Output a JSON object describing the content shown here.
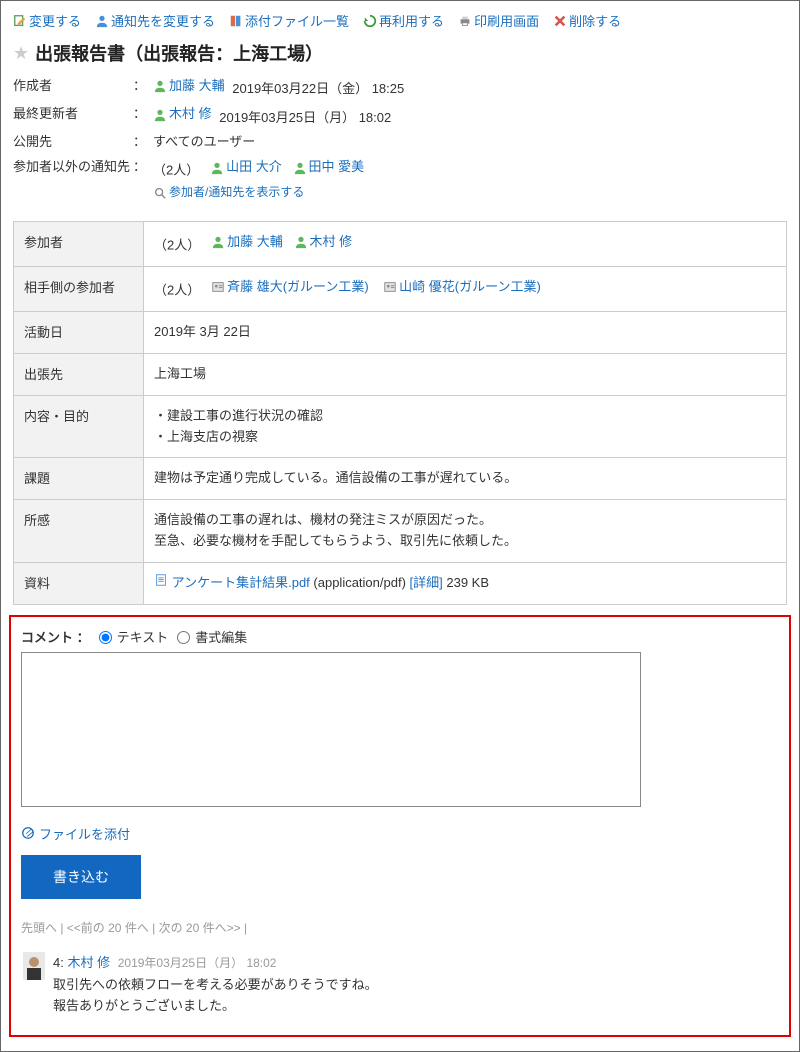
{
  "toolbar": {
    "edit": "変更する",
    "notif": "通知先を変更する",
    "files": "添付ファイル一覧",
    "reuse": "再利用する",
    "print": "印刷用画面",
    "delete": "削除する"
  },
  "title": "出張報告書（出張報告：上海工場）",
  "meta": {
    "creator_label": "作成者",
    "creator_name": "加藤 大輔",
    "creator_date": "2019年03月22日（金） 18:25",
    "updater_label": "最終更新者",
    "updater_name": "木村 修",
    "updater_date": "2019年03月25日（月） 18:02",
    "visibility_label": "公開先",
    "visibility_value": "すべてのユーザー",
    "notify_label": "参加者以外の通知先",
    "notify_count": "（2人）",
    "notify_user1": "山田 大介",
    "notify_user2": "田中 愛美",
    "show_participants": "参加者/通知先を表示する"
  },
  "detail": {
    "participants_label": "参加者",
    "participants_count": "（2人）",
    "participant1": "加藤 大輔",
    "participant2": "木村 修",
    "other_label": "相手側の参加者",
    "other_count": "（2人）",
    "other1": "斉藤 雄大(ガルーン工業)",
    "other2": "山崎 優花(ガルーン工業)",
    "date_label": "活動日",
    "date_value": "2019年 3月 22日",
    "place_label": "出張先",
    "place_value": "上海工場",
    "purpose_label": "内容・目的",
    "purpose_value": "・建設工事の進行状況の確認\n・上海支店の視察",
    "issue_label": "課題",
    "issue_value": "建物は予定通り完成している。通信設備の工事が遅れている。",
    "impression_label": "所感",
    "impression_value": "通信設備の工事の遅れは、機材の発注ミスが原因だった。\n至急、必要な機材を手配してもらうよう、取引先に依頼した。",
    "material_label": "資料",
    "material_file": "アンケート集計結果.pdf",
    "material_mime": " (application/pdf) ",
    "material_detail": "[詳細]",
    "material_size": " 239 KB"
  },
  "comment": {
    "label": "コメント ：",
    "opt_text": "テキスト",
    "opt_format": "書式編集",
    "attach": "ファイルを添付",
    "submit": "書き込む"
  },
  "pager": "先頭へ  |  <<前の 20 件へ  |  次の 20 件へ>>  |",
  "comments": [
    {
      "no": "4:",
      "user": "木村 修",
      "date": "2019年03月25日（月） 18:02",
      "text": "取引先への依頼フローを考える必要がありそうですね。\n報告ありがとうございました。"
    }
  ]
}
